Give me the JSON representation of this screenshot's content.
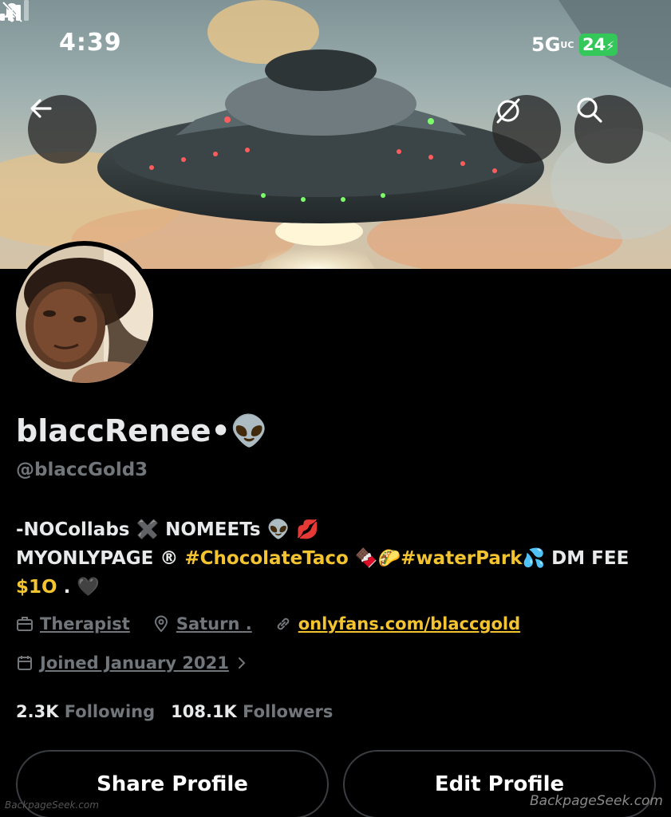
{
  "status_bar": {
    "time": "4:39",
    "network": "5G",
    "network_sup": "UC",
    "battery": "24"
  },
  "header": {
    "back_icon": "arrow-left-icon",
    "grok_icon": "grok-slash-circle-icon",
    "search_icon": "search-icon"
  },
  "profile": {
    "display_name": "blaccRenee•👽",
    "handle": "@blaccGold3",
    "bio": {
      "line1": "-NOCollabs ✖️ NOMEETs 👽 💋",
      "line2_start": "MYONLYPAGE ® ",
      "tag1": "#ChocolateTaco",
      "emoji1": " 🍫🌮",
      "tag2": "#waterPark",
      "line2_end": "💦 DM FEE",
      "price": "$1O",
      "line3_end": " . 🖤"
    },
    "profession": "Therapist",
    "location": "Saturn .",
    "website": "onlyfans.com/blaccgold",
    "joined": "Joined January 2021",
    "following_count": "2.3K",
    "following_label": "Following",
    "followers_count": "108.1K",
    "followers_label": "Followers"
  },
  "actions": {
    "share": "Share Profile",
    "edit": "Edit Profile"
  },
  "watermark": {
    "right": "BackpageSeek.com",
    "left": "BackpageSeek.com"
  },
  "colors": {
    "background": "#000000",
    "text": "#e7e9ea",
    "muted": "#71767b",
    "accent": "#f4c430",
    "battery": "#34c759"
  }
}
